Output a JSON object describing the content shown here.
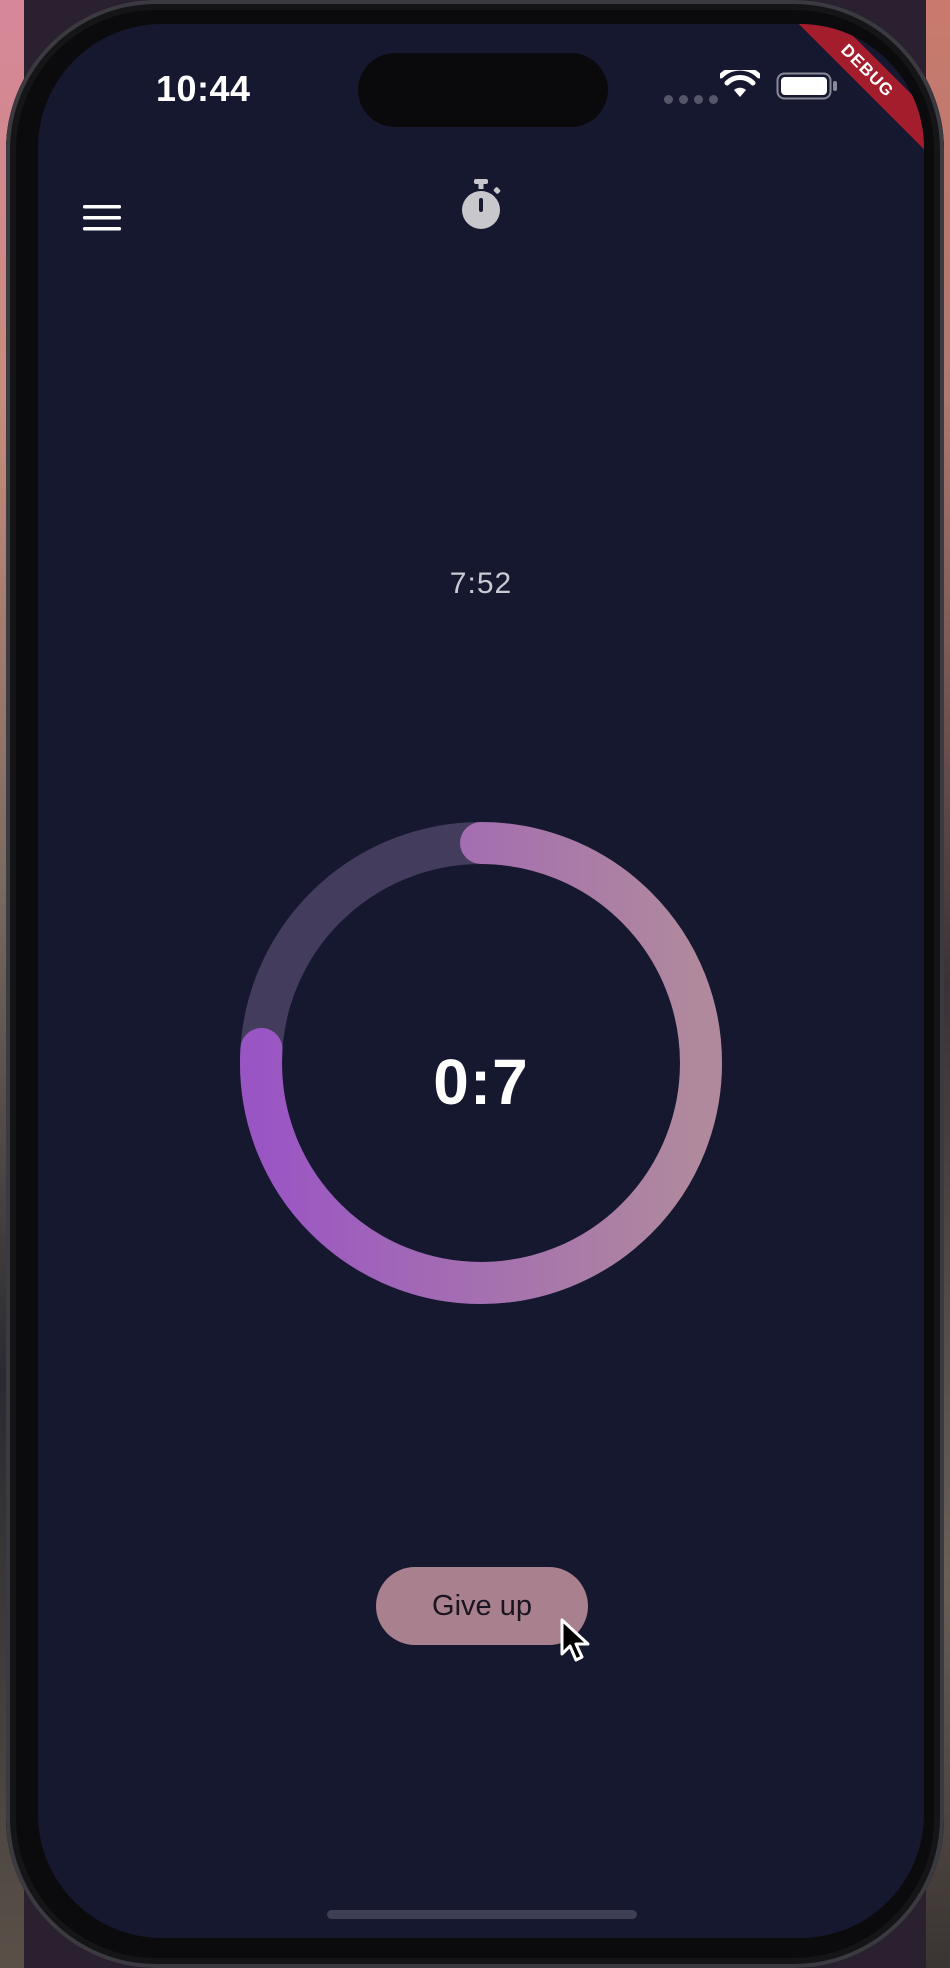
{
  "status_bar": {
    "time": "10:44",
    "wifi_icon": "wifi-icon",
    "battery_icon": "battery-icon"
  },
  "debug_banner": {
    "label": "DEBUG",
    "color": "#a41d2c"
  },
  "app_bar": {
    "menu_icon": "hamburger-menu-icon",
    "title_icon": "stopwatch-icon"
  },
  "timer": {
    "target_time": "7:52",
    "countdown": "0:7",
    "progress_fraction": 0.76,
    "track_color": "#433c5c",
    "progress_color_start": "#9a55c4",
    "progress_color_end": "#b08a9c"
  },
  "actions": {
    "give_up_label": "Give up",
    "button_color": "#a9808e"
  },
  "colors": {
    "background": "#161830",
    "text_primary": "#ffffff"
  }
}
